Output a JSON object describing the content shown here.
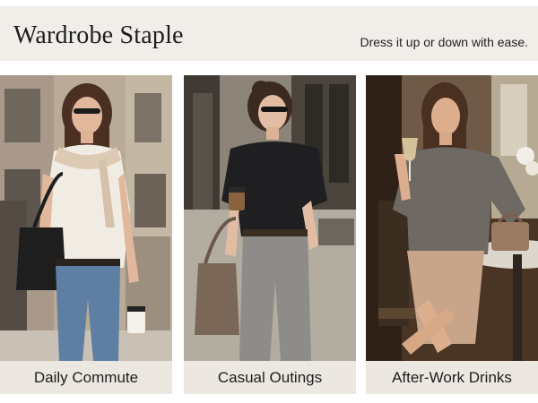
{
  "header": {
    "title": "Wardrobe Staple",
    "tagline": "Dress it up or down with ease."
  },
  "cards": [
    {
      "caption": "Daily Commute",
      "photo": "woman-street-commute-photo"
    },
    {
      "caption": "Casual Outings",
      "photo": "woman-casual-outing-photo"
    },
    {
      "caption": "After-Work Drinks",
      "photo": "woman-after-work-drinks-photo"
    }
  ],
  "colors": {
    "header_bg": "#f1eeea",
    "caption_bg": "#ece7e0",
    "text": "#1c1c1c"
  }
}
